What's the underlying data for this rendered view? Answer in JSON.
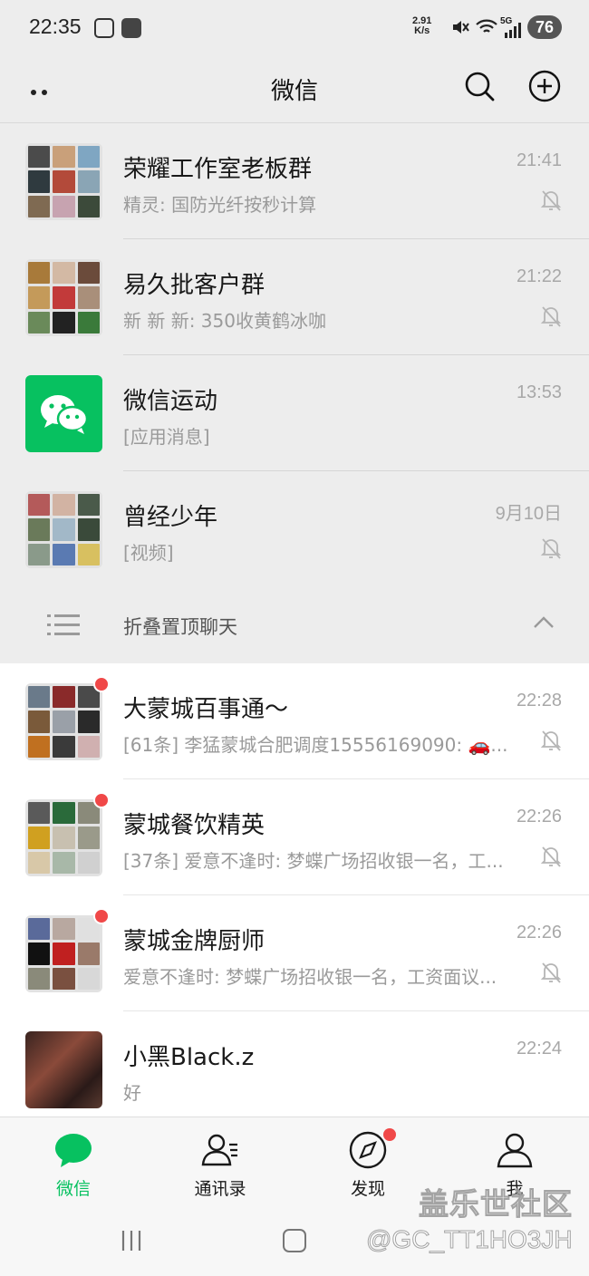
{
  "status_bar": {
    "time": "22:35",
    "speed_value": "2.91",
    "speed_unit": "K/s",
    "signal_label": "5G",
    "battery": "76"
  },
  "header": {
    "title": "微信"
  },
  "pinned_chats": [
    {
      "name": "荣耀工作室老板群",
      "preview": "精灵: 国防光纤按秒计算",
      "time": "21:41",
      "muted": true
    },
    {
      "name": "易久批客户群",
      "preview": "新  新  新: 350收黄鹤冰咖",
      "time": "21:22",
      "muted": true
    },
    {
      "name": "微信运动",
      "preview": "[应用消息]",
      "time": "13:53",
      "muted": false
    },
    {
      "name": "曾经少年",
      "preview": "[视频]",
      "time": "9月10日",
      "muted": true
    }
  ],
  "fold": {
    "label": "折叠置顶聊天"
  },
  "chats": [
    {
      "name": "大蒙城百事通～",
      "preview": "[61条] 李猛蒙城合肥调度15556169090: 🚗...",
      "time": "22:28",
      "muted": true,
      "unread_dot": true
    },
    {
      "name": "蒙城餐饮精英",
      "preview": "[37条] 爱意不逢时: 梦蝶广场招收银一名，工...",
      "time": "22:26",
      "muted": true,
      "unread_dot": true
    },
    {
      "name": "蒙城金牌厨师",
      "preview": "爱意不逢时: 梦蝶广场招收银一名，工资面议...",
      "time": "22:26",
      "muted": true,
      "unread_dot": true
    },
    {
      "name": "小黑Black.z",
      "preview": "好",
      "time": "22:24",
      "muted": false,
      "unread_dot": false
    }
  ],
  "tabs": [
    {
      "label": "微信",
      "icon": "chat-bubble-icon",
      "active": true
    },
    {
      "label": "通讯录",
      "icon": "contacts-icon",
      "active": false
    },
    {
      "label": "发现",
      "icon": "compass-icon",
      "active": false,
      "dot": true
    },
    {
      "label": "我",
      "icon": "person-icon",
      "active": false
    }
  ],
  "watermark": {
    "line1": "盖乐世社区",
    "line2": "@GC_TT1HO3JH"
  },
  "colors": {
    "accent": "#07c160",
    "unread": "#f04848",
    "pinned_bg": "#ededed"
  }
}
